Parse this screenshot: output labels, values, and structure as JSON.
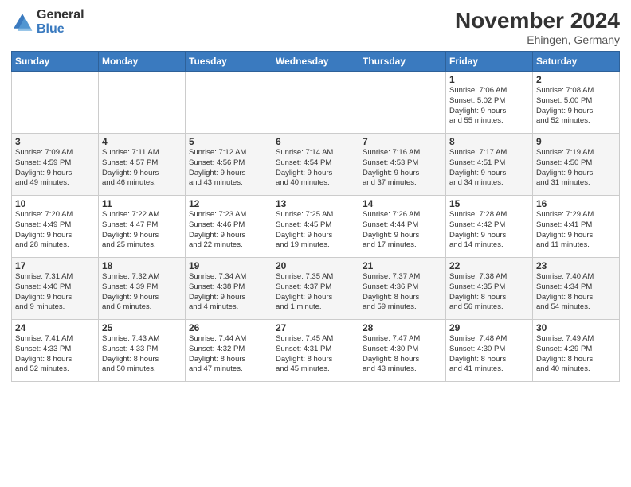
{
  "logo": {
    "line1": "General",
    "line2": "Blue"
  },
  "title": "November 2024",
  "location": "Ehingen, Germany",
  "header_days": [
    "Sunday",
    "Monday",
    "Tuesday",
    "Wednesday",
    "Thursday",
    "Friday",
    "Saturday"
  ],
  "weeks": [
    [
      {
        "day": "",
        "info": ""
      },
      {
        "day": "",
        "info": ""
      },
      {
        "day": "",
        "info": ""
      },
      {
        "day": "",
        "info": ""
      },
      {
        "day": "",
        "info": ""
      },
      {
        "day": "1",
        "info": "Sunrise: 7:06 AM\nSunset: 5:02 PM\nDaylight: 9 hours\nand 55 minutes."
      },
      {
        "day": "2",
        "info": "Sunrise: 7:08 AM\nSunset: 5:00 PM\nDaylight: 9 hours\nand 52 minutes."
      }
    ],
    [
      {
        "day": "3",
        "info": "Sunrise: 7:09 AM\nSunset: 4:59 PM\nDaylight: 9 hours\nand 49 minutes."
      },
      {
        "day": "4",
        "info": "Sunrise: 7:11 AM\nSunset: 4:57 PM\nDaylight: 9 hours\nand 46 minutes."
      },
      {
        "day": "5",
        "info": "Sunrise: 7:12 AM\nSunset: 4:56 PM\nDaylight: 9 hours\nand 43 minutes."
      },
      {
        "day": "6",
        "info": "Sunrise: 7:14 AM\nSunset: 4:54 PM\nDaylight: 9 hours\nand 40 minutes."
      },
      {
        "day": "7",
        "info": "Sunrise: 7:16 AM\nSunset: 4:53 PM\nDaylight: 9 hours\nand 37 minutes."
      },
      {
        "day": "8",
        "info": "Sunrise: 7:17 AM\nSunset: 4:51 PM\nDaylight: 9 hours\nand 34 minutes."
      },
      {
        "day": "9",
        "info": "Sunrise: 7:19 AM\nSunset: 4:50 PM\nDaylight: 9 hours\nand 31 minutes."
      }
    ],
    [
      {
        "day": "10",
        "info": "Sunrise: 7:20 AM\nSunset: 4:49 PM\nDaylight: 9 hours\nand 28 minutes."
      },
      {
        "day": "11",
        "info": "Sunrise: 7:22 AM\nSunset: 4:47 PM\nDaylight: 9 hours\nand 25 minutes."
      },
      {
        "day": "12",
        "info": "Sunrise: 7:23 AM\nSunset: 4:46 PM\nDaylight: 9 hours\nand 22 minutes."
      },
      {
        "day": "13",
        "info": "Sunrise: 7:25 AM\nSunset: 4:45 PM\nDaylight: 9 hours\nand 19 minutes."
      },
      {
        "day": "14",
        "info": "Sunrise: 7:26 AM\nSunset: 4:44 PM\nDaylight: 9 hours\nand 17 minutes."
      },
      {
        "day": "15",
        "info": "Sunrise: 7:28 AM\nSunset: 4:42 PM\nDaylight: 9 hours\nand 14 minutes."
      },
      {
        "day": "16",
        "info": "Sunrise: 7:29 AM\nSunset: 4:41 PM\nDaylight: 9 hours\nand 11 minutes."
      }
    ],
    [
      {
        "day": "17",
        "info": "Sunrise: 7:31 AM\nSunset: 4:40 PM\nDaylight: 9 hours\nand 9 minutes."
      },
      {
        "day": "18",
        "info": "Sunrise: 7:32 AM\nSunset: 4:39 PM\nDaylight: 9 hours\nand 6 minutes."
      },
      {
        "day": "19",
        "info": "Sunrise: 7:34 AM\nSunset: 4:38 PM\nDaylight: 9 hours\nand 4 minutes."
      },
      {
        "day": "20",
        "info": "Sunrise: 7:35 AM\nSunset: 4:37 PM\nDaylight: 9 hours\nand 1 minute."
      },
      {
        "day": "21",
        "info": "Sunrise: 7:37 AM\nSunset: 4:36 PM\nDaylight: 8 hours\nand 59 minutes."
      },
      {
        "day": "22",
        "info": "Sunrise: 7:38 AM\nSunset: 4:35 PM\nDaylight: 8 hours\nand 56 minutes."
      },
      {
        "day": "23",
        "info": "Sunrise: 7:40 AM\nSunset: 4:34 PM\nDaylight: 8 hours\nand 54 minutes."
      }
    ],
    [
      {
        "day": "24",
        "info": "Sunrise: 7:41 AM\nSunset: 4:33 PM\nDaylight: 8 hours\nand 52 minutes."
      },
      {
        "day": "25",
        "info": "Sunrise: 7:43 AM\nSunset: 4:33 PM\nDaylight: 8 hours\nand 50 minutes."
      },
      {
        "day": "26",
        "info": "Sunrise: 7:44 AM\nSunset: 4:32 PM\nDaylight: 8 hours\nand 47 minutes."
      },
      {
        "day": "27",
        "info": "Sunrise: 7:45 AM\nSunset: 4:31 PM\nDaylight: 8 hours\nand 45 minutes."
      },
      {
        "day": "28",
        "info": "Sunrise: 7:47 AM\nSunset: 4:30 PM\nDaylight: 8 hours\nand 43 minutes."
      },
      {
        "day": "29",
        "info": "Sunrise: 7:48 AM\nSunset: 4:30 PM\nDaylight: 8 hours\nand 41 minutes."
      },
      {
        "day": "30",
        "info": "Sunrise: 7:49 AM\nSunset: 4:29 PM\nDaylight: 8 hours\nand 40 minutes."
      }
    ]
  ]
}
